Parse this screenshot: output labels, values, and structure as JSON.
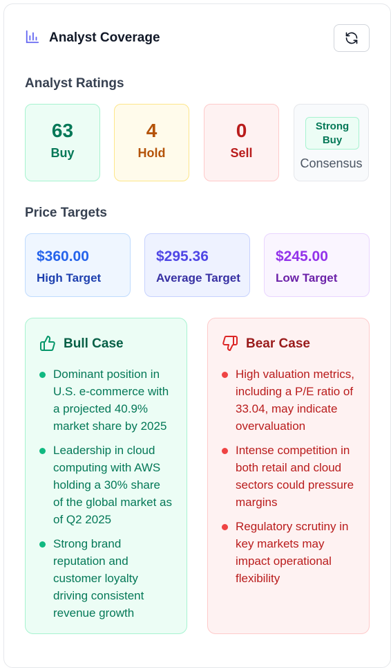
{
  "header": {
    "title": "Analyst Coverage",
    "icon": "bar-chart-icon",
    "refresh_icon": "refresh-icon"
  },
  "ratings": {
    "section_title": "Analyst Ratings",
    "buy": {
      "count": "63",
      "label": "Buy"
    },
    "hold": {
      "count": "4",
      "label": "Hold"
    },
    "sell": {
      "count": "0",
      "label": "Sell"
    },
    "consensus": {
      "badge": "Strong Buy",
      "label": "Consensus"
    }
  },
  "targets": {
    "section_title": "Price Targets",
    "high": {
      "value": "$360.00",
      "label": "High Target"
    },
    "average": {
      "value": "$295.36",
      "label": "Average Target"
    },
    "low": {
      "value": "$245.00",
      "label": "Low Target"
    }
  },
  "bull": {
    "title": "Bull Case",
    "icon": "thumbs-up-icon",
    "points": [
      "Dominant position in U.S. e-commerce with a projected 40.9% market share by 2025",
      "Leadership in cloud computing with AWS holding a 30% share of the global market as of Q2 2025",
      "Strong brand reputation and customer loyalty driving consistent revenue growth"
    ]
  },
  "bear": {
    "title": "Bear Case",
    "icon": "thumbs-down-icon",
    "points": [
      "High valuation metrics, including a P/E ratio of 33.04, may indicate overvaluation",
      "Intense competition in both retail and cloud sectors could pressure margins",
      "Regulatory scrutiny in key markets may impact operational flexibility"
    ]
  },
  "colors": {
    "buy": "#047857",
    "hold": "#b45309",
    "sell": "#b91c1c",
    "high_target": "#2563eb",
    "average_target": "#4f46e5",
    "low_target": "#9333ea"
  }
}
